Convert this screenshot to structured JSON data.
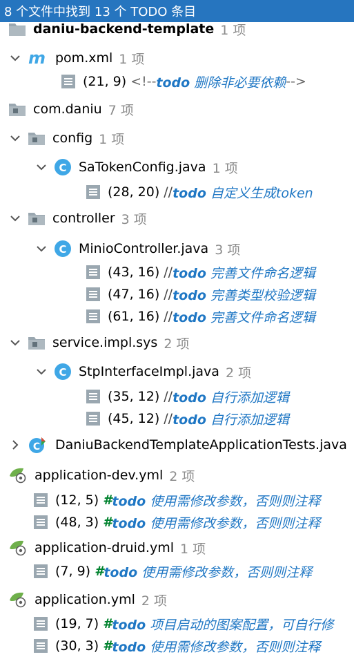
{
  "header": {
    "summary": "8 个文件中找到 13 个 TODO 条目"
  },
  "tree": [
    {
      "kind": "module",
      "label": "daniu-backend-template",
      "count": "1 项"
    },
    {
      "kind": "maven",
      "label": "pom.xml",
      "count": "1 项"
    },
    {
      "kind": "todo-xml",
      "loc": "(21, 9)",
      "prefix": "<!--",
      "kw": "todo",
      "text": " 删除非必要依赖",
      "suffix": "-->"
    },
    {
      "kind": "package-root",
      "label": "com.daniu",
      "count": "7 项"
    },
    {
      "kind": "package",
      "label": "config",
      "count": "1 项"
    },
    {
      "kind": "class",
      "label": "SaTokenConfig.java",
      "count": "1 项"
    },
    {
      "kind": "todo-java",
      "loc": "(28, 20)",
      "prefix": "//",
      "kw": "todo",
      "text": " 自定义生成token"
    },
    {
      "kind": "package",
      "label": "controller",
      "count": "3 项"
    },
    {
      "kind": "class",
      "label": "MinioController.java",
      "count": "3 项"
    },
    {
      "kind": "todo-java",
      "loc": "(43, 16)",
      "prefix": "//",
      "kw": "todo",
      "text": " 完善文件命名逻辑"
    },
    {
      "kind": "todo-java",
      "loc": "(47, 16)",
      "prefix": "//",
      "kw": "todo",
      "text": " 完善类型校验逻辑"
    },
    {
      "kind": "todo-java",
      "loc": "(61, 16)",
      "prefix": "//",
      "kw": "todo",
      "text": " 完善文件命名逻辑"
    },
    {
      "kind": "package",
      "label": "service.impl.sys",
      "count": "2 项"
    },
    {
      "kind": "class",
      "label": "StpInterfaceImpl.java",
      "count": "2 项"
    },
    {
      "kind": "todo-java",
      "loc": "(35, 12)",
      "prefix": "//",
      "kw": "todo",
      "text": " 自行添加逻辑"
    },
    {
      "kind": "todo-java",
      "loc": "(45, 12)",
      "prefix": "//",
      "kw": "todo",
      "text": " 自行添加逻辑"
    },
    {
      "kind": "test-class",
      "label": "DaniuBackendTemplateApplicationTests.java"
    },
    {
      "kind": "yml",
      "label": "application-dev.yml",
      "count": "2 项"
    },
    {
      "kind": "todo-yml",
      "loc": "(12, 5)",
      "prefix": "#",
      "kw": "todo",
      "text": " 使用需修改参数，否则则注释"
    },
    {
      "kind": "todo-yml",
      "loc": "(48, 3)",
      "prefix": "#",
      "kw": "todo",
      "text": " 使用需修改参数，否则则注释"
    },
    {
      "kind": "yml",
      "label": "application-druid.yml",
      "count": "1 项"
    },
    {
      "kind": "todo-yml",
      "loc": "(7, 9)",
      "prefix": "#",
      "kw": "todo",
      "text": " 使用需修改参数，否则则注释"
    },
    {
      "kind": "yml",
      "label": "application.yml",
      "count": "2 项"
    },
    {
      "kind": "todo-yml",
      "loc": "(19, 7)",
      "prefix": "#",
      "kw": "todo",
      "text": " 项目启动的图案配置，可自行修"
    },
    {
      "kind": "todo-yml",
      "loc": "(30, 3)",
      "prefix": "#",
      "kw": "todo",
      "text": " 使用需修改参数，否则则注释"
    }
  ]
}
